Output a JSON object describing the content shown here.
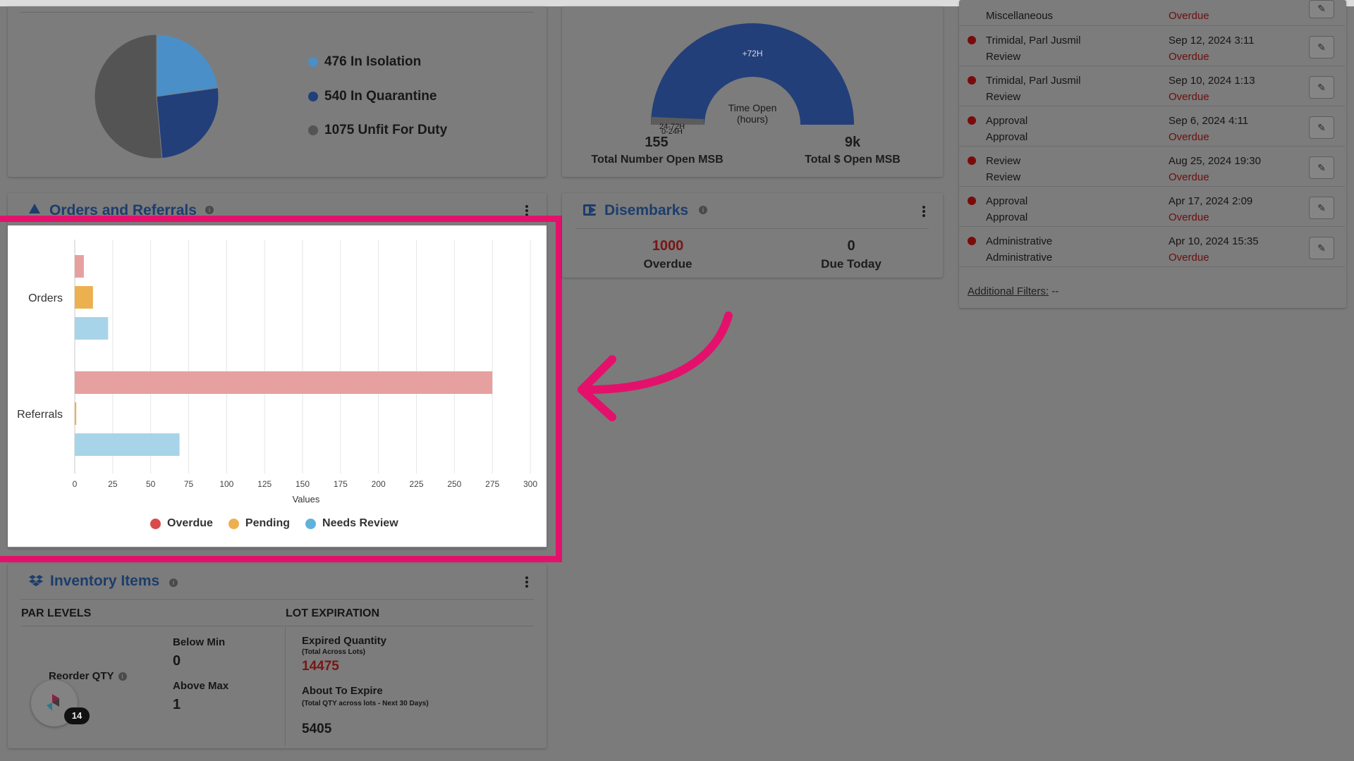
{
  "colors": {
    "accent": "#e3116c",
    "overdue": "#e6a0a0",
    "pending": "#edb050",
    "needs_review": "#a8d4ea",
    "danger": "#b52d2d",
    "title_blue": "#1d3d6b"
  },
  "status_pie": {
    "legend": [
      {
        "label": "476 In Isolation",
        "color": "#4a8fc7"
      },
      {
        "label": "540 In Quarantine",
        "color": "#223f7a"
      },
      {
        "label": "1075 Unfit For Duty",
        "color": "#545454"
      }
    ],
    "values": [
      476,
      540,
      1075
    ]
  },
  "msb_gauge": {
    "center_label": "Time Open",
    "center_sublabel": "(hours)",
    "top_label": "+72H",
    "small_labels": [
      "24-72H",
      "0-24H"
    ],
    "total_number_value": "155",
    "total_number_label": "Total Number Open MSB",
    "total_dollar_value": "9k",
    "total_dollar_label": "Total $ Open MSB"
  },
  "orders_referrals": {
    "title": "Orders and Referrals",
    "info_icon": "i"
  },
  "chart_data": {
    "type": "bar",
    "orientation": "horizontal",
    "categories": [
      "Orders",
      "Referrals"
    ],
    "series": [
      {
        "name": "Overdue",
        "values": [
          6,
          275
        ],
        "color": "#e6a0a0"
      },
      {
        "name": "Pending",
        "values": [
          12,
          1
        ],
        "color": "#edb050"
      },
      {
        "name": "Needs Review",
        "values": [
          22,
          69
        ],
        "color": "#a8d4ea"
      }
    ],
    "xlabel": "Values",
    "xlim": [
      0,
      300
    ],
    "ticks": [
      "0",
      "25",
      "50",
      "75",
      "100",
      "125",
      "150",
      "175",
      "200",
      "225",
      "250",
      "275",
      "300"
    ],
    "grid": true,
    "legend": "bottom",
    "legend_colors": [
      "#d94b4b",
      "#edb050",
      "#5fb2dc"
    ]
  },
  "disembarks": {
    "title": "Disembarks",
    "overdue_value": "1000",
    "overdue_label": "Overdue",
    "due_today_value": "0",
    "due_today_label": "Due Today"
  },
  "task_list": {
    "partial_row": {
      "line1": "Miscellaneous",
      "status": "Overdue"
    },
    "rows": [
      {
        "line1": "Trimidal, Parl Jusmil",
        "line2": "Review",
        "date": "Sep 12, 2024 3:11",
        "status": "Overdue"
      },
      {
        "line1": "Trimidal, Parl Jusmil",
        "line2": "Review",
        "date": "Sep 10, 2024 1:13",
        "status": "Overdue"
      },
      {
        "line1": "Approval",
        "line2": "Approval",
        "date": "Sep 6, 2024 4:11",
        "status": "Overdue"
      },
      {
        "line1": "Review",
        "line2": "Review",
        "date": "Aug 25, 2024 19:30",
        "status": "Overdue"
      },
      {
        "line1": "Approval",
        "line2": "Approval",
        "date": "Apr 17, 2024 2:09",
        "status": "Overdue"
      },
      {
        "line1": "Administrative",
        "line2": "Administrative",
        "date": "Apr 10, 2024 15:35",
        "status": "Overdue"
      }
    ],
    "filters_label": "Additional Filters:",
    "filters_value": "--"
  },
  "inventory": {
    "title": "Inventory Items",
    "par_levels": "PAR LEVELS",
    "lot_expiration": "LOT EXPIRATION",
    "below_min_label": "Below Min",
    "below_min_value": "0",
    "above_max_label": "Above Max",
    "above_max_value": "1",
    "reorder_label": "Reorder QTY",
    "badge": "14",
    "expired_label": "Expired Quantity",
    "expired_sub": "(Total Across Lots)",
    "expired_value": "14475",
    "about_label": "About To Expire",
    "about_sub": "(Total QTY across lots - Next 30 Days)",
    "about_value": "5405"
  }
}
